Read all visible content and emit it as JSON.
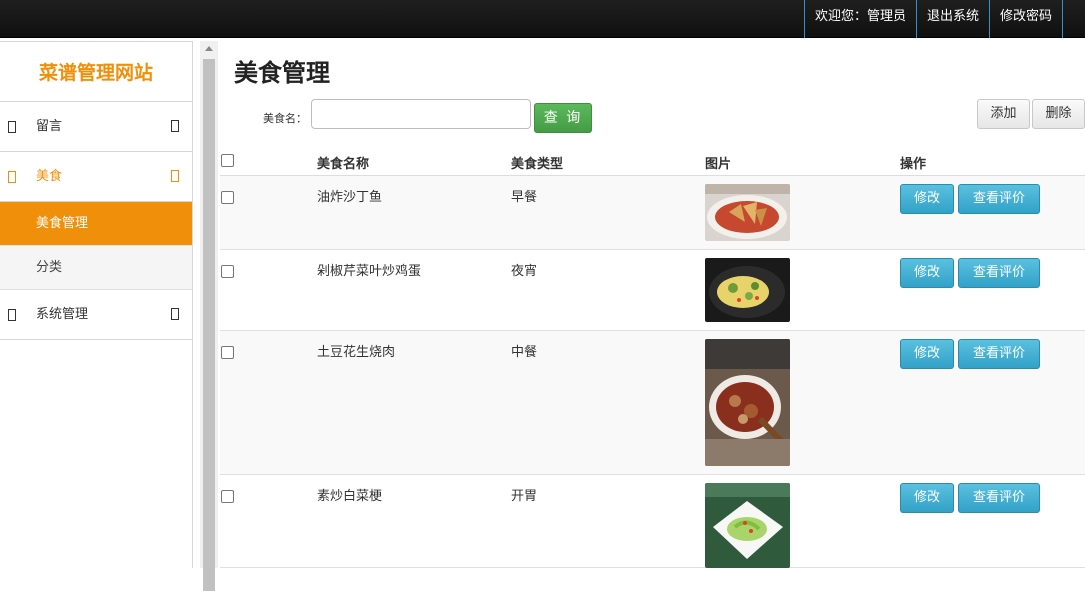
{
  "topbar": {
    "welcome": "欢迎您：管理员",
    "logout": "退出系统",
    "change_password": "修改密码"
  },
  "sidebar": {
    "brand": "菜谱管理网站",
    "groups": [
      {
        "label": "留言",
        "icon": "message-icon"
      },
      {
        "label": "美食",
        "icon": "food-icon",
        "active": true,
        "children": [
          "美食管理",
          "分类"
        ]
      },
      {
        "label": "系统管理",
        "icon": "settings-icon"
      }
    ],
    "selected_child": "美食管理",
    "accent": "#f0900a"
  },
  "main": {
    "title": "美食管理",
    "search": {
      "label": "美食名：",
      "value": "",
      "query_button": "查 询"
    },
    "add_button": "添加",
    "delete_button": "删除",
    "columns": [
      "美食名称",
      "美食类型",
      "图片",
      "操作"
    ],
    "rows": [
      {
        "name": "油炸沙丁鱼",
        "type": "早餐",
        "edit": "修改",
        "review": "查看评价",
        "image_desc": "fried-fish-photo"
      },
      {
        "name": "剁椒芹菜叶炒鸡蛋",
        "type": "夜宵",
        "edit": "修改",
        "review": "查看评价",
        "image_desc": "celery-egg-photo"
      },
      {
        "name": "土豆花生烧肉",
        "type": "中餐",
        "edit": "修改",
        "review": "查看评价",
        "image_desc": "braised-pork-photo"
      },
      {
        "name": "素炒白菜梗",
        "type": "开胃",
        "edit": "修改",
        "review": "查看评价",
        "image_desc": "cabbage-photo"
      }
    ]
  },
  "colors": {
    "topbar": "#151515",
    "query_button": "#5cb85c",
    "action_button": "#5bc0de"
  }
}
